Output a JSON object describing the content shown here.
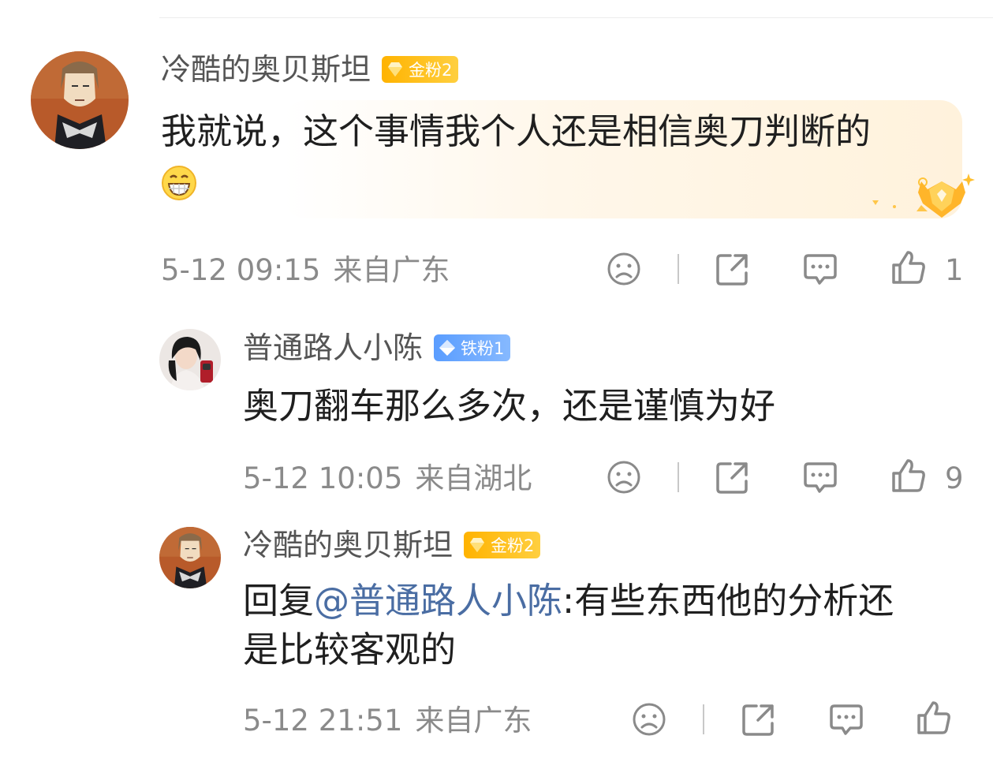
{
  "comments": [
    {
      "username": "冷酷的奥贝斯坦",
      "badge": "金粉2",
      "text": "我就说，这个事情我个人还是相信奥刀判断的",
      "emoji": "grin-emoji",
      "date": "5-12 09:15",
      "location": "来自广东",
      "likes": "1"
    },
    {
      "username": "普通路人小陈",
      "badge": "铁粉1",
      "text": "奥刀翻车那么多次，还是谨慎为好",
      "date": "5-12 10:05",
      "location": "来自湖北",
      "likes": "9"
    },
    {
      "username": "冷酷的奥贝斯坦",
      "badge": "金粉2",
      "reply_prefix": "回复",
      "mention": "@普通路人小陈",
      "text_line1": ":有些东西他的分析还",
      "text_line2": "是比较客观的",
      "date": "5-12 21:51",
      "location": "来自广东",
      "likes": ""
    }
  ],
  "colors": {
    "gold_badge": "#ffb300",
    "iron_badge": "#5a9dff",
    "mention": "#4a6da3",
    "meta_text": "#8a8a8a"
  },
  "icons": [
    "dislike-icon",
    "share-icon",
    "reply-icon",
    "like-icon"
  ]
}
